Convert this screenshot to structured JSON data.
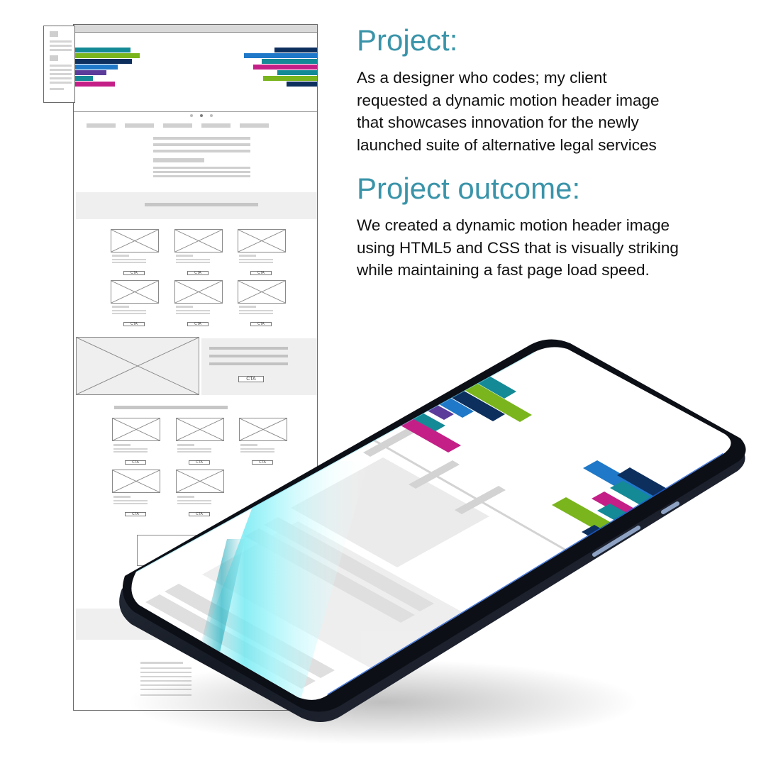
{
  "project": {
    "heading": "Project:",
    "lines": [
      "As a designer who codes; my client",
      "requested a dynamic motion header image",
      "that showcases innovation for the newly",
      "launched suite of alternative legal services"
    ]
  },
  "outcome": {
    "heading": "Project outcome:",
    "lines": [
      "We created a dynamic motion header image",
      "using HTML5 and CSS that is visually striking",
      "while maintaining a fast page load speed."
    ]
  },
  "wireframe": {
    "cta_label": "CTA"
  },
  "colors": {
    "accent": "#3a94a9",
    "brand_teal": "#148a96",
    "brand_green": "#7ab51d",
    "brand_navy": "#0d2f5e",
    "brand_blue": "#1f78c8",
    "brand_purple": "#5b3c9a",
    "brand_magenta": "#c41f87"
  }
}
